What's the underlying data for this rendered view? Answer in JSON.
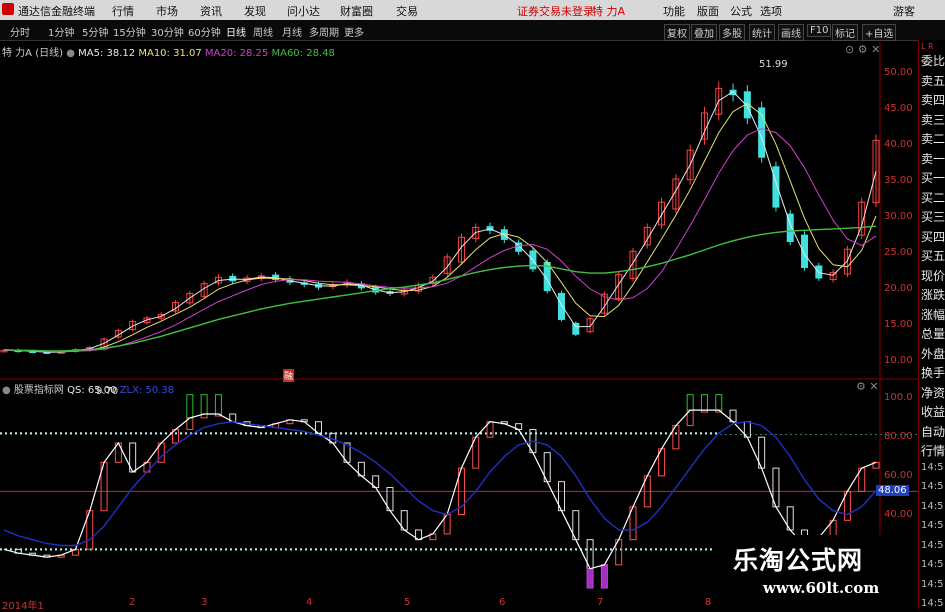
{
  "menubar": {
    "app_title": "通达信金融终端",
    "menus": [
      "行情",
      "市场",
      "资讯",
      "发现",
      "问小达",
      "财富圈",
      "交易"
    ],
    "status": "证券交易未登录",
    "stock": "特 力A",
    "right_menus": [
      "功能",
      "版面",
      "公式",
      "选项"
    ],
    "user": "游客"
  },
  "periodbar": {
    "periods": [
      "分时",
      "1分钟",
      "5分钟",
      "15分钟",
      "30分钟",
      "60分钟",
      "日线",
      "周线",
      "月线",
      "多周期",
      "更多"
    ],
    "active": "日线",
    "buttons": [
      "复权",
      "叠加",
      "多股",
      "统计",
      "画线",
      "F10",
      "标记",
      "+自选"
    ]
  },
  "sidebar": {
    "top_letters": "L R",
    "items": [
      "委比",
      "卖五",
      "卖四",
      "卖三",
      "卖二",
      "卖一",
      "买一",
      "买二",
      "买三",
      "买四",
      "买五",
      "现价",
      "涨跌",
      "涨幅",
      "总量",
      "外盘",
      "换手",
      "净资",
      "收益",
      "自动",
      "行情",
      "14:5",
      "14:5",
      "14:5",
      "14:5",
      "14:5",
      "14:5",
      "14:5",
      "14:5"
    ]
  },
  "main_chart": {
    "header": {
      "name": "特 力A",
      "period": "(日线)",
      "ma5": "MA5: 38.12",
      "ma10": "MA10: 31.07",
      "ma20": "MA20: 28.25",
      "ma60": "MA60: 28.48"
    },
    "yticks": [
      "50.00",
      "45.00",
      "40.00",
      "35.00",
      "30.00",
      "25.00",
      "20.00",
      "15.00",
      "10.00"
    ],
    "high_label": "51.99",
    "low_label": "9.70",
    "marker": "融"
  },
  "indicator": {
    "name": "股票指标网",
    "qs": "QS: 65.00",
    "zlx": "ZLX: 50.38",
    "yticks": [
      "100.0",
      "80.00",
      "60.00",
      "40.00"
    ],
    "current_value": "48.06"
  },
  "x_axis": [
    "2014年1",
    "2",
    "3",
    "4",
    "5",
    "6",
    "7",
    "8"
  ],
  "watermark": {
    "cn": "乐淘公式网",
    "url": "www.60lt.com"
  },
  "colors": {
    "ma5": "#e8e8e8",
    "ma10": "#e8e070",
    "ma20": "#d040d0",
    "ma60": "#40c040",
    "up": "#ff4040",
    "down": "#40e0e0"
  },
  "chart_data": {
    "type": "candlestick",
    "price": {
      "ylim": [
        8,
        53
      ],
      "close": [
        10.8,
        10.7,
        10.6,
        10.5,
        10.6,
        10.9,
        11.2,
        12.4,
        13.6,
        14.9,
        15.4,
        15.9,
        17.6,
        18.9,
        20.3,
        21.2,
        20.7,
        21.1,
        21.4,
        20.9,
        20.5,
        20.2,
        19.8,
        20.1,
        20.5,
        19.7,
        19.1,
        18.9,
        19.4,
        20.1,
        21.2,
        24.1,
        26.9,
        28.3,
        27.9,
        26.6,
        24.9,
        22.4,
        19.3,
        15.2,
        13.1,
        15.3,
        18.8,
        21.6,
        24.9,
        28.3,
        31.9,
        35.2,
        39.3,
        44.6,
        48.1,
        47.2,
        43.9,
        38.3,
        31.2,
        26.3,
        22.6,
        21.1,
        21.9,
        25.2,
        31.9,
        40.7
      ],
      "ma60": [
        10.9,
        10.8,
        10.8,
        10.7,
        10.7,
        10.8,
        10.9,
        11.1,
        11.4,
        11.8,
        12.3,
        12.8,
        13.4,
        14.0,
        14.6,
        15.2,
        15.7,
        16.2,
        16.7,
        17.1,
        17.5,
        17.8,
        18.1,
        18.4,
        18.7,
        19.0,
        19.3,
        19.6,
        19.8,
        20.1,
        20.4,
        20.9,
        21.4,
        21.9,
        22.3,
        22.6,
        22.8,
        22.9,
        22.8,
        22.4,
        22.0,
        21.8,
        21.8,
        22.0,
        22.3,
        22.7,
        23.2,
        23.8,
        24.4,
        25.1,
        25.8,
        26.4,
        26.9,
        27.3,
        27.6,
        27.8,
        27.9,
        28.0,
        28.1,
        28.2,
        28.3,
        28.48
      ]
    },
    "indicator": {
      "ylim": [
        0,
        105
      ],
      "qs": [
        20,
        18,
        17,
        16,
        17,
        20,
        40,
        65,
        75,
        60,
        65,
        75,
        82,
        88,
        90,
        90,
        86,
        84,
        83,
        85,
        87,
        86,
        80,
        75,
        65,
        58,
        52,
        40,
        30,
        25,
        28,
        38,
        62,
        78,
        86,
        85,
        82,
        70,
        55,
        40,
        25,
        10,
        12,
        25,
        42,
        58,
        72,
        84,
        92,
        92,
        92,
        86,
        78,
        62,
        42,
        30,
        22,
        26,
        35,
        50,
        62,
        65
      ],
      "zlx": [
        30,
        27,
        25,
        23,
        22,
        22,
        25,
        32,
        42,
        52,
        60,
        68,
        74,
        79,
        83,
        85,
        86,
        85,
        84,
        83,
        82,
        81,
        79,
        77,
        74,
        70,
        65,
        59,
        52,
        45,
        40,
        38,
        42,
        50,
        60,
        68,
        74,
        76,
        74,
        68,
        58,
        46,
        36,
        30,
        30,
        34,
        42,
        52,
        62,
        72,
        80,
        85,
        86,
        84,
        78,
        68,
        56,
        46,
        40,
        38,
        42,
        50.38
      ],
      "hlines": [
        80,
        50,
        20
      ]
    }
  }
}
